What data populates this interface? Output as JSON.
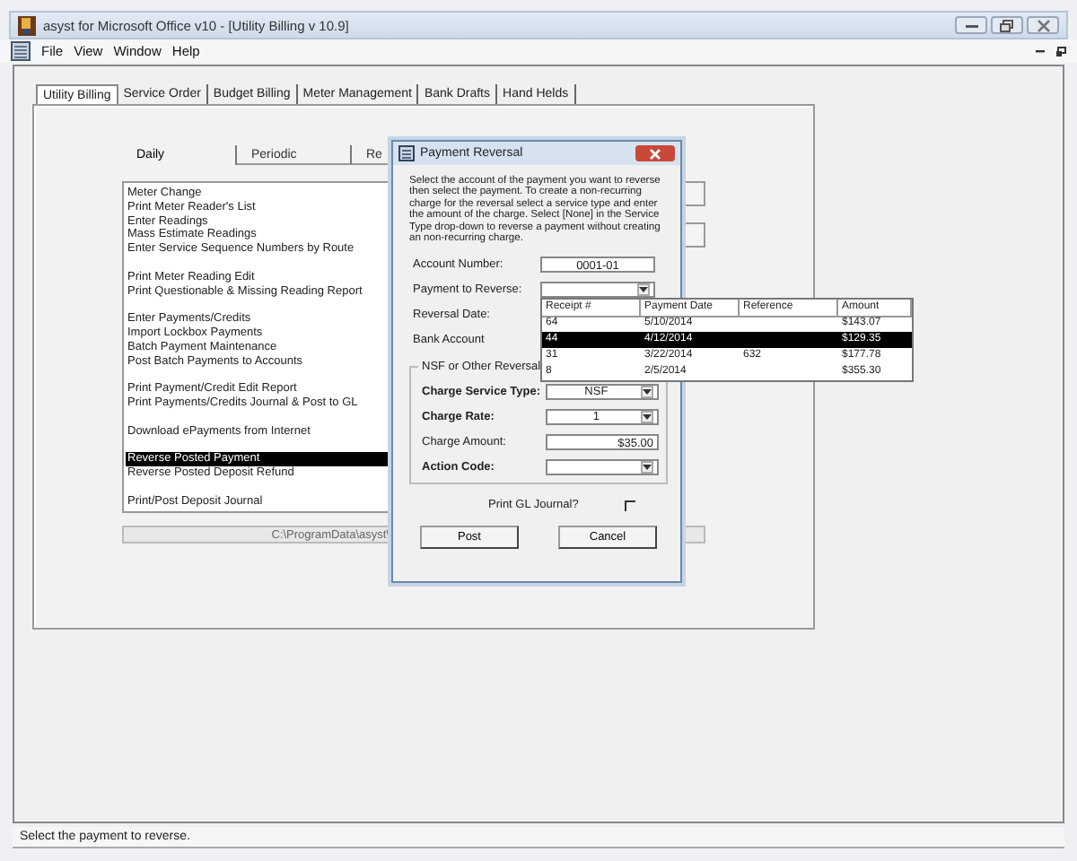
{
  "window": {
    "title": "asyst for Microsoft Office v10 - [Utility Billing   v 10.9]"
  },
  "menu": [
    "File",
    "View",
    "Window",
    "Help"
  ],
  "tabs": [
    {
      "label": "Utility Billing",
      "selected": true
    },
    {
      "label": "Service Order",
      "selected": false
    },
    {
      "label": "Budget Billing",
      "selected": false
    },
    {
      "label": "Meter Management",
      "selected": false
    },
    {
      "label": "Bank Drafts",
      "selected": false
    },
    {
      "label": "Hand Helds",
      "selected": false
    }
  ],
  "sub_tabs": [
    {
      "label": "Daily",
      "selected": true
    },
    {
      "label": "Periodic",
      "selected": false
    },
    {
      "label": "Re",
      "selected": false
    }
  ],
  "task_groups": [
    {
      "items": [
        {
          "label": "Meter Change",
          "selected": false
        },
        {
          "label": "Print Meter Reader's List",
          "selected": false
        },
        {
          "label": "Enter Readings",
          "selected": false
        },
        {
          "label": "Mass Estimate Readings",
          "selected": false
        },
        {
          "label": "Enter Service Sequence Numbers by Route",
          "selected": false
        }
      ]
    },
    {
      "items": [
        {
          "label": "Print Meter Reading Edit",
          "selected": false
        },
        {
          "label": "Print Questionable & Missing Reading Report",
          "selected": false
        }
      ]
    },
    {
      "items": [
        {
          "label": "Enter Payments/Credits",
          "selected": false
        },
        {
          "label": "Import Lockbox Payments",
          "selected": false
        },
        {
          "label": "Batch Payment Maintenance",
          "selected": false
        },
        {
          "label": "Post Batch Payments to Accounts",
          "selected": false
        }
      ]
    },
    {
      "items": [
        {
          "label": "Print Payment/Credit Edit Report",
          "selected": false
        },
        {
          "label": "Print Payments/Credits Journal & Post to GL",
          "selected": false
        }
      ]
    },
    {
      "items": [
        {
          "label": "Download ePayments from Internet",
          "selected": false
        }
      ]
    },
    {
      "items": [
        {
          "label": "Reverse Posted Payment",
          "selected": true
        },
        {
          "label": "Reverse Posted Deposit Refund",
          "selected": false
        }
      ]
    },
    {
      "items": [
        {
          "label": "Print/Post Deposit Journal",
          "selected": false
        }
      ]
    }
  ],
  "path_field": {
    "value": "C:\\ProgramData\\asyst\\"
  },
  "dialog": {
    "title": "Payment Reversal",
    "instructions": "Select the account of the payment you want to reverse then select the payment.  To create a non-recurring charge for the reversal select a service type and enter the amount of the charge.  Select [None] in the Service Type drop-down to reverse a payment without creating an non-recurring charge.",
    "fields": [
      {
        "kind": "text",
        "label": "Account Number:",
        "value": "0001-01"
      },
      {
        "kind": "dropdown",
        "label": "Payment to Reverse:",
        "open": true
      },
      {
        "kind": "label",
        "label": "Reversal Date:"
      },
      {
        "kind": "label",
        "label": "Bank Account"
      }
    ],
    "charge_group": {
      "title": "NSF or Other Reversal",
      "fields": [
        {
          "kind": "dropdown",
          "label": "Charge Service Type:",
          "value": "NSF",
          "bold": true
        },
        {
          "kind": "dropdown",
          "label": "Charge Rate:",
          "value": "1",
          "bold": true
        },
        {
          "kind": "amount",
          "label": "Charge Amount:",
          "value": "$35.00",
          "bold": false
        },
        {
          "kind": "dropdown",
          "label": "Action Code:",
          "bold": true
        }
      ]
    },
    "print_gl_journal": {
      "label": "Print GL Journal?",
      "checked": false
    },
    "buttons": [
      "Post",
      "Cancel"
    ]
  },
  "payment_dropdown": {
    "columns": [
      "Receipt #",
      "Payment Date",
      "Reference",
      "Amount"
    ],
    "rows": [
      {
        "receipt": "64",
        "payment_date": "5/10/2014",
        "amount": "$143.07",
        "selected": false
      },
      {
        "receipt": "44",
        "payment_date": "4/12/2014",
        "amount": "$129.35",
        "selected": true
      },
      {
        "receipt": "31",
        "payment_date": "3/22/2014",
        "reference": "632",
        "amount": "$177.78",
        "selected": false
      },
      {
        "receipt": "8",
        "payment_date": "2/5/2014",
        "amount": "$355.30",
        "selected": false
      }
    ]
  },
  "status_bar": "Select the payment to reverse."
}
